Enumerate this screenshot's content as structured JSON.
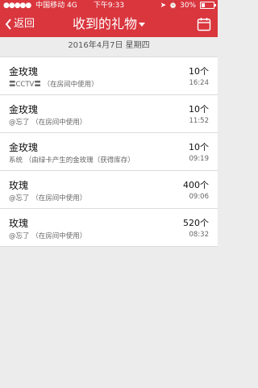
{
  "status": {
    "carrier": "中国移动",
    "network": "4G",
    "time": "下午9:33",
    "battery": "30%",
    "battery_level": 0.3
  },
  "nav": {
    "back_label": "返回",
    "title": "收到的礼物"
  },
  "date_header": "2016年4月7日 星期四",
  "gifts": [
    {
      "name": "金玫瑰",
      "desc": "〓CCTV〓  （在房间中使用）",
      "count": "10个",
      "time": "16:24"
    },
    {
      "name": "金玫瑰",
      "desc": "@忘了  （在房间中使用）",
      "count": "10个",
      "time": "11:52"
    },
    {
      "name": "金玫瑰",
      "desc": "系统  （由绿卡产生的金玫瑰（获得库存）",
      "count": "10个",
      "time": "09:19"
    },
    {
      "name": "玫瑰",
      "desc": "@忘了  （在房间中使用）",
      "count": "400个",
      "time": "09:06"
    },
    {
      "name": "玫瑰",
      "desc": "@忘了  （在房间中使用）",
      "count": "520个",
      "time": "08:32"
    }
  ],
  "colors": {
    "accent": "#d9363e",
    "background": "#ececec"
  }
}
